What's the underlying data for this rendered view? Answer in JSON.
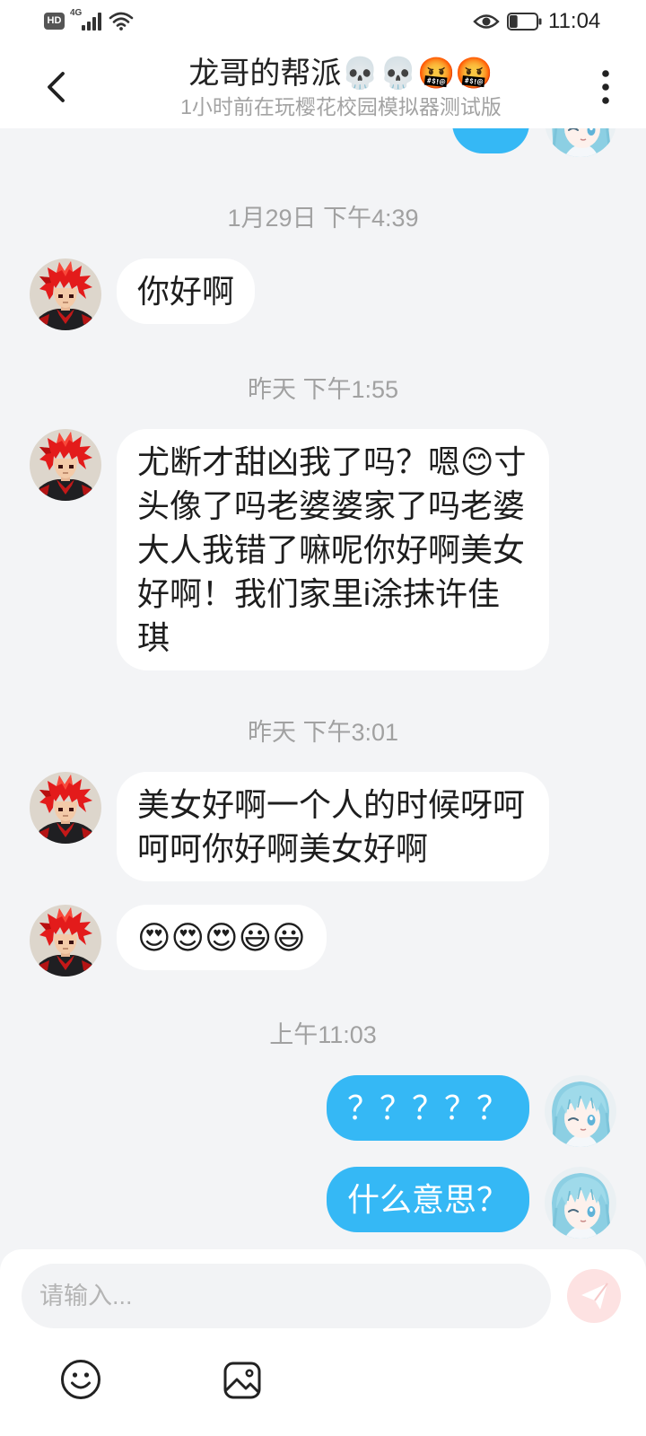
{
  "status_bar": {
    "hd_badge": "HD",
    "network": "4G",
    "signal_bars": 4,
    "icons": [
      "signal-icon",
      "wifi-icon",
      "eye-icon",
      "battery-icon"
    ],
    "battery_level": 0.3,
    "time": "11:04"
  },
  "header": {
    "back_icon": "chevron-left-icon",
    "title": "龙哥的帮派💀💀🤬🤬",
    "subtitle": "1小时前在玩樱花校园模拟器测试版",
    "more_icon": "more-vertical-icon"
  },
  "avatars": {
    "contact": "red-haired-character-avatar",
    "me": "blue-haired-girl-avatar"
  },
  "chat": {
    "items": [
      {
        "timestamp": "1月29日 下午4:39"
      },
      {
        "incoming": "你好啊"
      },
      {
        "timestamp": "昨天 下午1:55"
      },
      {
        "incoming": "尤断才甜凶我了吗？嗯😊寸头像了吗老婆婆家了吗老婆大人我错了嘛呢你好啊美女好啊！我们家里i涂抹许佳琪"
      },
      {
        "timestamp": "昨天 下午3:01"
      },
      {
        "incoming": "美女好啊一个人的时候呀呵呵呵你好啊美女好啊"
      },
      {
        "incoming": "😍😍😍😃😃"
      },
      {
        "timestamp": "上午11:03"
      },
      {
        "outgoing": "？？？？？"
      },
      {
        "outgoing": "什么意思？"
      }
    ]
  },
  "composer": {
    "placeholder": "请输入...",
    "send_icon": "paper-plane-icon",
    "emoji_icon": "smiley-icon",
    "image_icon": "image-icon"
  },
  "colors": {
    "chat_background": "#f3f4f6",
    "incoming_bubble": "#ffffff",
    "outgoing_bubble": "#35b8f5",
    "outgoing_text": "#ffffff",
    "send_button": "#fde2e2",
    "timestamp_text": "#a1a1a1"
  }
}
